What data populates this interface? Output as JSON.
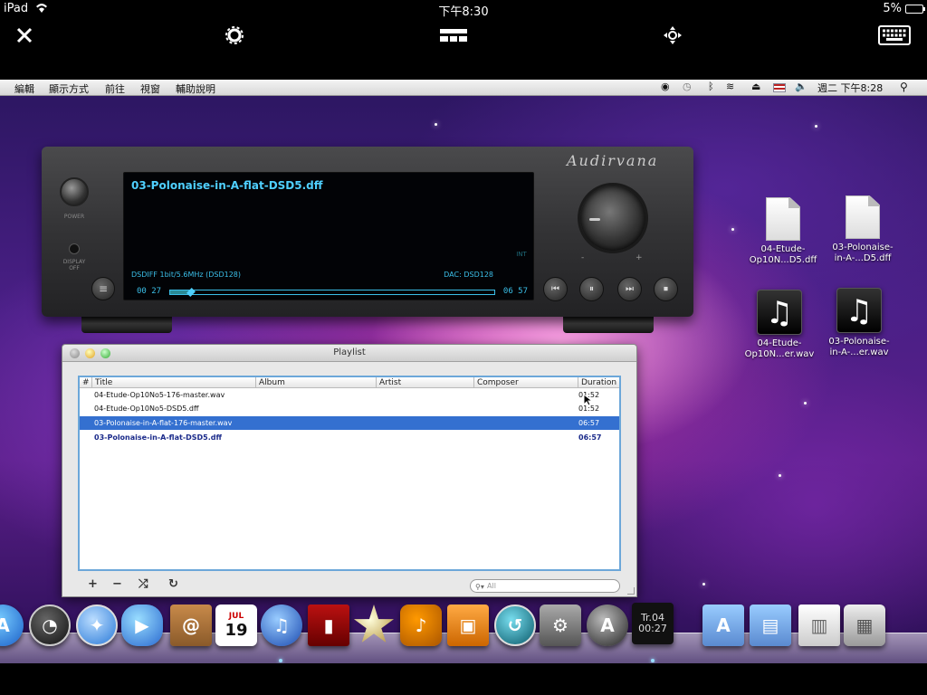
{
  "ipad_status": {
    "device": "iPad",
    "time": "下午8:30",
    "battery": "5%"
  },
  "remote_toolbar": [
    {
      "name": "close-button",
      "icon": "✕"
    },
    {
      "name": "settings-button",
      "icon": "⚙"
    },
    {
      "name": "screen-layout-button",
      "icon": "▦"
    },
    {
      "name": "move-button",
      "icon": "✥"
    },
    {
      "name": "keyboard-button",
      "icon": "⌨"
    }
  ],
  "menubar": {
    "items": [
      "編輯",
      "顯示方式",
      "前往",
      "視窗",
      "輔助說明"
    ],
    "clock": "週二 下午8:28",
    "search_icon": "magnifier"
  },
  "player": {
    "brand": "Audirvana",
    "power_label": "POWER",
    "display_label": "DISPLAY OFF",
    "track_title": "03-Polonaise-in-A-flat-DSD5.dff",
    "format": "DSDIFF 1bit/5.6MHz (DSD128)",
    "dac": "DAC: DSD128",
    "side_tag": "INT",
    "elapsed": "00 27",
    "total": "06 57",
    "progress_fraction": 0.065,
    "vol_minus": "-",
    "vol_plus": "+",
    "menu_icon": "≡",
    "buttons": {
      "prev": "⏮",
      "pause": "⏸",
      "next": "⏭",
      "stop": "⏹"
    }
  },
  "playlist": {
    "title": "Playlist",
    "columns": [
      "#",
      "Title",
      "Album",
      "Artist",
      "Composer",
      "Duration"
    ],
    "rows": [
      {
        "title": "04-Etude-Op10No5-176-master.wav",
        "duration": "01:52",
        "state": "normal"
      },
      {
        "title": "04-Etude-Op10No5-DSD5.dff",
        "duration": "01:52",
        "state": "normal"
      },
      {
        "title": "03-Polonaise-in-A-flat-176-master.wav",
        "duration": "06:57",
        "state": "selected"
      },
      {
        "title": "03-Polonaise-in-A-flat-DSD5.dff",
        "duration": "06:57",
        "state": "playing"
      }
    ],
    "toolbar": {
      "add": "+",
      "remove": "−",
      "shuffle": "⤮",
      "repeat": "↻"
    },
    "search_placeholder": "All"
  },
  "desktop_icons": [
    {
      "label1": "04-Etude-",
      "label2": "Op10N...D5.dff",
      "kind": "document"
    },
    {
      "label1": "03-Polonaise-",
      "label2": "in-A-...D5.dff",
      "kind": "document"
    },
    {
      "label1": "04-Etude-",
      "label2": "Op10N...er.wav",
      "kind": "music"
    },
    {
      "label1": "03-Polonaise-",
      "label2": "in-A-...er.wav",
      "kind": "music"
    }
  ],
  "dock": {
    "calendar": {
      "month": "JUL",
      "day": "19"
    },
    "audio_widget": {
      "line1": "Tr.04",
      "line2": "00:27"
    },
    "items": [
      "app-store",
      "dashboard",
      "safari",
      "ichat",
      "address-book",
      "ical",
      "itunes",
      "front-row",
      "imovie",
      "garageband",
      "iphoto",
      "time-machine",
      "system-preferences",
      "aperture",
      "audirvana",
      "applications-folder",
      "documents-folder",
      "downloads-stack",
      "trash"
    ]
  }
}
